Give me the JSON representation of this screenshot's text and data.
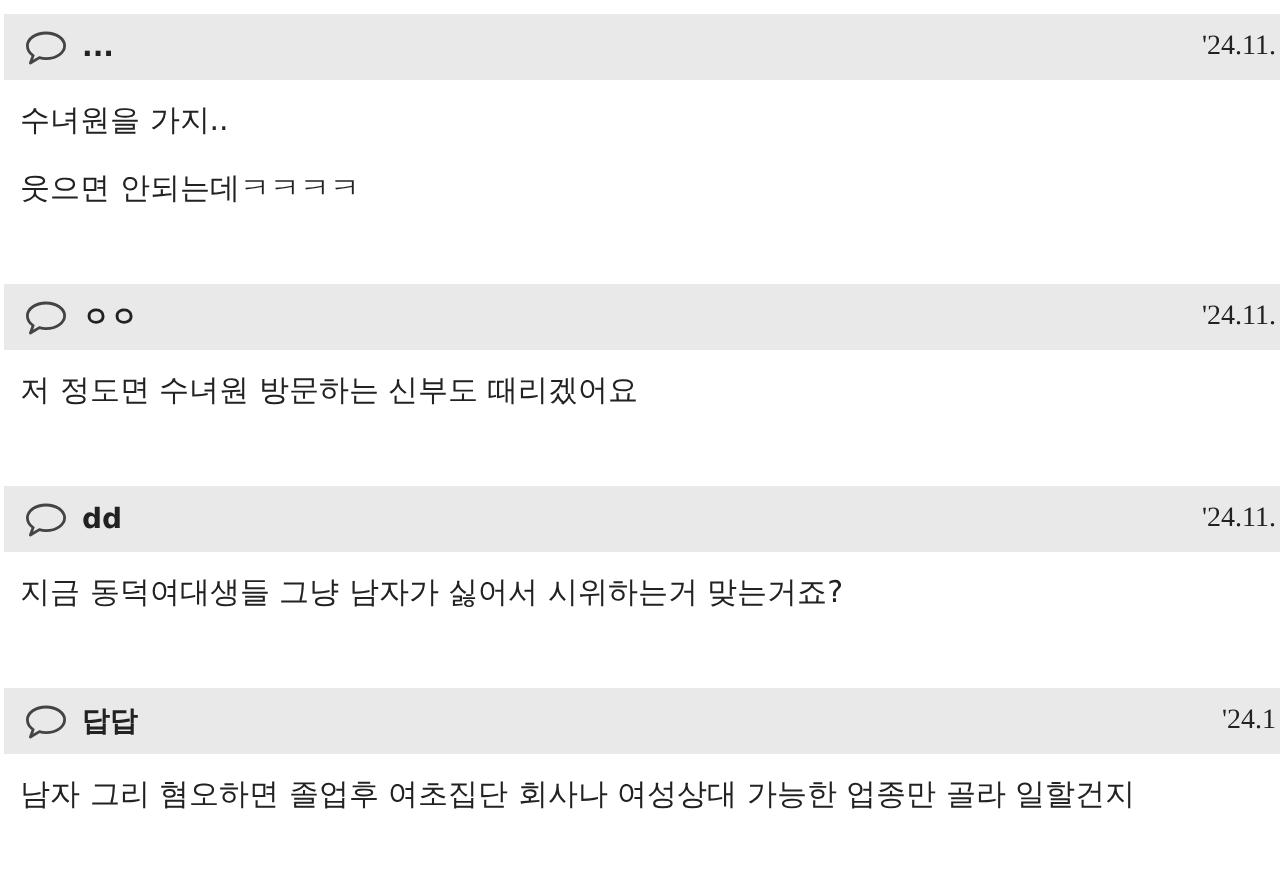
{
  "comments": [
    {
      "nickname": "...",
      "date": "'24.11.",
      "lines": [
        "수녀원을 가지..",
        "웃으면 안되는데ㅋㅋㅋㅋ"
      ]
    },
    {
      "nickname": "ㅇㅇ",
      "date": "'24.11.",
      "lines": [
        "저 정도면 수녀원 방문하는 신부도 때리겠어요"
      ]
    },
    {
      "nickname": "dd",
      "date": "'24.11.",
      "lines": [
        "지금 동덕여대생들 그냥 남자가 싫어서 시위하는거 맞는거죠?"
      ]
    },
    {
      "nickname": "답답",
      "date": "'24.1",
      "lines": [
        "남자 그리 혐오하면 졸업후 여초집단 회사나 여성상대 가능한 업종만 골라 일할건지"
      ]
    }
  ]
}
